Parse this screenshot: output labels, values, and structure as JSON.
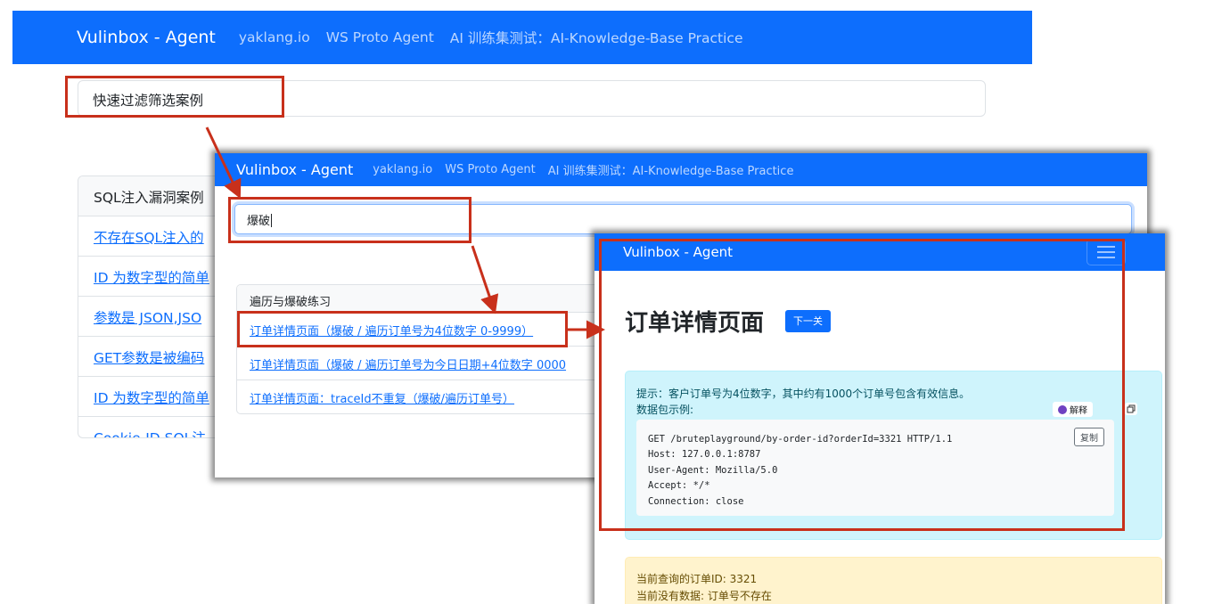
{
  "layer1": {
    "brand": "Vulinbox - Agent",
    "nav_links": [
      "yaklang.io",
      "WS Proto Agent",
      "AI 训练集测试：AI-Knowledge-Base Practice"
    ],
    "filter_placeholder": "快速过滤筛选案例",
    "card_title": "SQL注入漏洞案例",
    "card_items": [
      "不存在SQL注入的",
      "ID 为数字型的简单",
      "参数是 JSON,JSO",
      "GET参数是被编码",
      "ID 为数字型的简单",
      "Cookie-ID SQL注"
    ]
  },
  "layer2": {
    "brand": "Vulinbox - Agent",
    "nav_links": [
      "yaklang.io",
      "WS Proto Agent",
      "AI 训练集测试：AI-Knowledge-Base Practice"
    ],
    "filter_value": "爆破",
    "card_title": "遍历与爆破练习",
    "card_items": [
      "订单详情页面（爆破 / 遍历订单号为4位数字 0-9999）",
      "订单详情页面（爆破 / 遍历订单号为今日日期+4位数字 0000",
      "订单详情页面：traceId不重复（爆破/遍历订单号）"
    ]
  },
  "layer3": {
    "brand": "Vulinbox - Agent",
    "title": "订单详情页面",
    "next_button": "下一关",
    "hint_line1": "提示：客户订单号为4位数字，其中约有1000个订单号包含有效信息。",
    "hint_line2": "数据包示例:",
    "explain_label": "解释",
    "copy_label": "复制",
    "code": "GET /bruteplayground/by-order-id?orderId=3321 HTTP/1.1\nHost: 127.0.0.1:8787\nUser-Agent: Mozilla/5.0\nAccept: */*\nConnection: close",
    "status_line1": "当前查询的订单ID: 3321",
    "status_line2": "当前没有数据: 订单号不存在"
  },
  "colors": {
    "primary": "#0d6efd",
    "highlight": "#c8301b",
    "info_bg": "#cff4fc",
    "warning_bg": "#fff3cd"
  },
  "icons": [
    "hamburger-menu-icon",
    "ai-explain-icon",
    "copy-icon"
  ]
}
